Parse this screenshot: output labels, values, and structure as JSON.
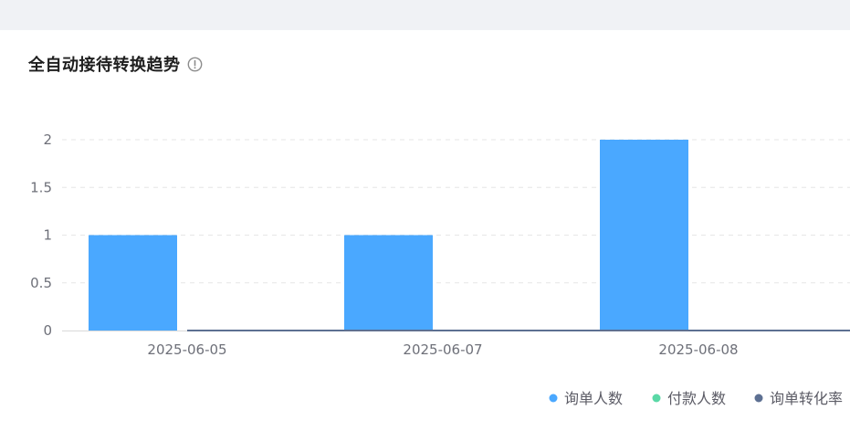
{
  "header": {
    "title": "全自动接待转换趋势",
    "info_icon": "info-circle-icon"
  },
  "chart_data": {
    "type": "bar",
    "categories": [
      "2025-06-05",
      "2025-06-07",
      "2025-06-08"
    ],
    "series": [
      {
        "name": "询单人数",
        "values": [
          1,
          1,
          2
        ],
        "color": "#4aa8ff",
        "kind": "bar"
      },
      {
        "name": "付款人数",
        "values": [
          0,
          0,
          0
        ],
        "color": "#5ad8a6",
        "kind": "bar"
      },
      {
        "name": "询单转化率",
        "values": [
          0,
          0,
          0
        ],
        "color": "#5d7092",
        "kind": "line"
      }
    ],
    "y_ticks": [
      "0",
      "0.5",
      "1",
      "1.5",
      "2"
    ],
    "ylim": [
      0,
      2
    ],
    "grid": true,
    "legend_position": "bottom-right",
    "title": "",
    "xlabel": "",
    "ylabel": ""
  }
}
